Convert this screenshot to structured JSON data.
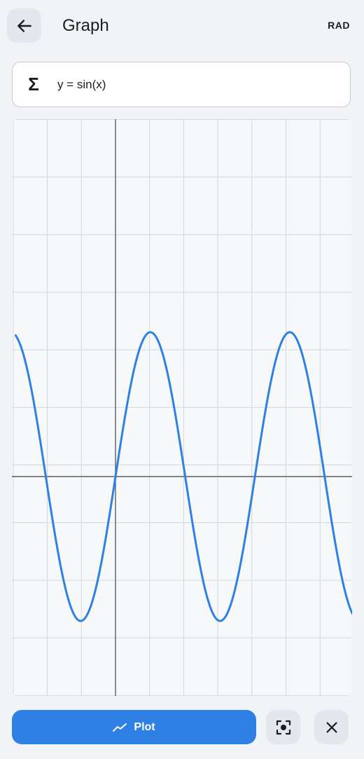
{
  "header": {
    "title": "Graph",
    "angle_mode": "RAD",
    "back_icon": "arrow-left-icon"
  },
  "expression": {
    "symbol": "Σ",
    "text": "y = sin(x)"
  },
  "graph": {
    "function": "sin(x)",
    "curve_color": "#2f80e5",
    "grid_color": "#d3d7de",
    "axis_color": "#5a5e66",
    "x_range": [
      -4.5,
      10.8
    ],
    "y_range": [
      -3.2,
      2.05
    ]
  },
  "actions": {
    "plot_label": "Plot",
    "plot_icon": "trend-line-icon",
    "fit_icon": "focus-center-icon",
    "clear_icon": "close-icon",
    "accent_color": "#2f80e5"
  }
}
